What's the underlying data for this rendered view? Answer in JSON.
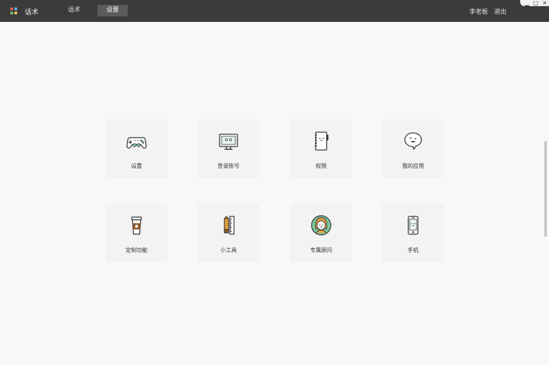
{
  "header": {
    "app_title": "话术",
    "tabs": [
      {
        "label": "话术",
        "active": false
      },
      {
        "label": "设置",
        "active": true
      }
    ],
    "user_name": "李老板",
    "logout_label": "退出",
    "window_controls": [
      "▁",
      "□",
      "✕"
    ]
  },
  "tiles": [
    {
      "label": "设置",
      "icon": "gamepad-icon"
    },
    {
      "label": "登录账号",
      "icon": "monitor-icon"
    },
    {
      "label": "权限",
      "icon": "notebook-icon"
    },
    {
      "label": "我的应用",
      "icon": "chat-bubble-icon"
    },
    {
      "label": "定制功能",
      "icon": "coffee-cup-icon"
    },
    {
      "label": "小工具",
      "icon": "pencil-ruler-icon"
    },
    {
      "label": "专属顾问",
      "icon": "advisor-avatar-icon"
    },
    {
      "label": "手机",
      "icon": "phone-icon"
    }
  ],
  "colors": {
    "titlebar": "#3b3b3b",
    "active_tab": "#5a5a5a",
    "background": "#f8f8f8",
    "tile": "#f3f3f3",
    "accent_green": "#7fc7a1",
    "accent_brown": "#8b5a2b"
  }
}
